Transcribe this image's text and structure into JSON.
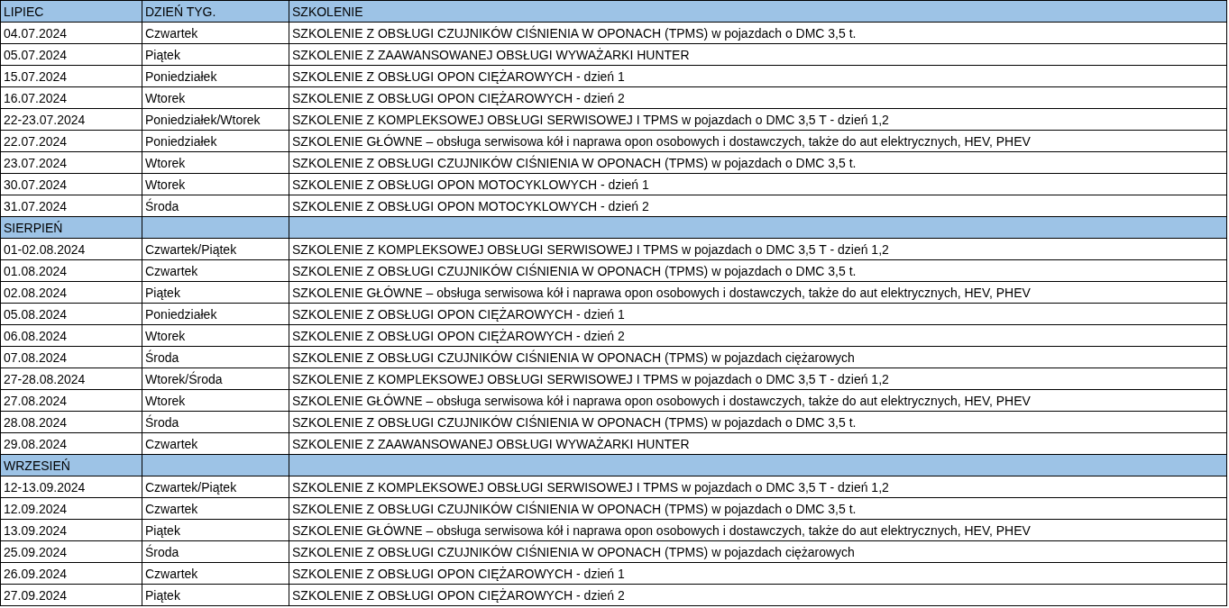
{
  "sections": [
    {
      "month": "LIPIEC",
      "headers": [
        "DZIEŃ TYG.",
        "SZKOLENIE"
      ],
      "rows": [
        {
          "date": "04.07.2024",
          "day": "Czwartek",
          "training": "SZKOLENIE Z OBSŁUGI CZUJNIKÓW CIŚNIENIA W OPONACH (TPMS) w pojazdach o DMC 3,5 t."
        },
        {
          "date": "05.07.2024",
          "day": "Piątek",
          "training": "SZKOLENIE Z ZAAWANSOWANEJ OBSŁUGI WYWAŻARKI HUNTER"
        },
        {
          "date": "15.07.2024",
          "day": "Poniedziałek",
          "training": "SZKOLENIE Z OBSŁUGI OPON CIĘŻAROWYCH - dzień 1"
        },
        {
          "date": "16.07.2024",
          "day": "Wtorek",
          "training": "SZKOLENIE Z OBSŁUGI OPON CIĘŻAROWYCH - dzień 2"
        },
        {
          "date": "22-23.07.2024",
          "day": "Poniedziałek/Wtorek",
          "training": "SZKOLENIE Z KOMPLEKSOWEJ OBSŁUGI SERWISOWEJ I TPMS w pojazdach o DMC 3,5 T - dzień 1,2"
        },
        {
          "date": "22.07.2024",
          "day": "Poniedziałek",
          "training": "SZKOLENIE GŁÓWNE – obsługa serwisowa kół i naprawa opon osobowych i dostawczych, także do aut elektrycznych, HEV, PHEV"
        },
        {
          "date": "23.07.2024",
          "day": "Wtorek",
          "training": "SZKOLENIE Z OBSŁUGI CZUJNIKÓW CIŚNIENIA W OPONACH (TPMS) w pojazdach o DMC 3,5 t."
        },
        {
          "date": "30.07.2024",
          "day": "Wtorek",
          "training": "SZKOLENIE Z OBSŁUGI OPON MOTOCYKLOWYCH - dzień 1"
        },
        {
          "date": "31.07.2024",
          "day": "Środa",
          "training": "SZKOLENIE Z OBSŁUGI OPON MOTOCYKLOWYCH - dzień 2"
        }
      ]
    },
    {
      "month": "SIERPIEŃ",
      "rows": [
        {
          "date": "01-02.08.2024",
          "day": "Czwartek/Piątek",
          "training": "SZKOLENIE Z KOMPLEKSOWEJ OBSŁUGI SERWISOWEJ I TPMS w pojazdach o DMC 3,5 T - dzień 1,2"
        },
        {
          "date": "01.08.2024",
          "day": "Czwartek",
          "training": "SZKOLENIE Z OBSŁUGI CZUJNIKÓW CIŚNIENIA W OPONACH (TPMS) w pojazdach o DMC 3,5 t."
        },
        {
          "date": "02.08.2024",
          "day": "Piątek",
          "training": "SZKOLENIE GŁÓWNE – obsługa serwisowa kół i naprawa opon osobowych i dostawczych, także do aut elektrycznych, HEV, PHEV"
        },
        {
          "date": "05.08.2024",
          "day": "Poniedziałek",
          "training": "SZKOLENIE Z OBSŁUGI OPON CIĘŻAROWYCH - dzień 1"
        },
        {
          "date": "06.08.2024",
          "day": "Wtorek",
          "training": "SZKOLENIE Z OBSŁUGI OPON CIĘŻAROWYCH - dzień 2"
        },
        {
          "date": "07.08.2024",
          "day": "Środa",
          "training": "SZKOLENIE Z OBSŁUGI CZUJNIKÓW CIŚNIENIA W OPONACH (TPMS) w pojazdach ciężarowych"
        },
        {
          "date": "27-28.08.2024",
          "day": "Wtorek/Środa",
          "training": "SZKOLENIE Z KOMPLEKSOWEJ OBSŁUGI SERWISOWEJ I TPMS w pojazdach o DMC 3,5 T - dzień 1,2"
        },
        {
          "date": "27.08.2024",
          "day": "Wtorek",
          "training": "SZKOLENIE GŁÓWNE – obsługa serwisowa kół i naprawa opon osobowych i dostawczych, także do aut elektrycznych, HEV, PHEV"
        },
        {
          "date": "28.08.2024",
          "day": "Środa",
          "training": "SZKOLENIE Z OBSŁUGI CZUJNIKÓW CIŚNIENIA W OPONACH (TPMS) w pojazdach o DMC 3,5 t."
        },
        {
          "date": "29.08.2024",
          "day": "Czwartek",
          "training": "SZKOLENIE Z ZAAWANSOWANEJ OBSŁUGI WYWAŻARKI HUNTER"
        }
      ]
    },
    {
      "month": "WRZESIEŃ",
      "rows": [
        {
          "date": "12-13.09.2024",
          "day": "Czwartek/Piątek",
          "training": "SZKOLENIE Z KOMPLEKSOWEJ OBSŁUGI SERWISOWEJ I TPMS w pojazdach o DMC 3,5 T - dzień 1,2"
        },
        {
          "date": "12.09.2024",
          "day": "Czwartek",
          "training": "SZKOLENIE Z OBSŁUGI CZUJNIKÓW CIŚNIENIA W OPONACH (TPMS) w pojazdach o DMC 3,5 t."
        },
        {
          "date": "13.09.2024",
          "day": "Piątek",
          "training": "SZKOLENIE GŁÓWNE – obsługa serwisowa kół i naprawa opon osobowych i dostawczych, także do aut elektrycznych, HEV, PHEV"
        },
        {
          "date": "25.09.2024",
          "day": "Środa",
          "training": "SZKOLENIE Z OBSŁUGI CZUJNIKÓW CIŚNIENIA W OPONACH (TPMS) w pojazdach ciężarowych"
        },
        {
          "date": "26.09.2024",
          "day": "Czwartek",
          "training": "SZKOLENIE Z OBSŁUGI OPON CIĘŻAROWYCH - dzień 1"
        },
        {
          "date": "27.09.2024",
          "day": "Piątek",
          "training": "SZKOLENIE Z OBSŁUGI OPON CIĘŻAROWYCH - dzień 2"
        }
      ]
    }
  ]
}
